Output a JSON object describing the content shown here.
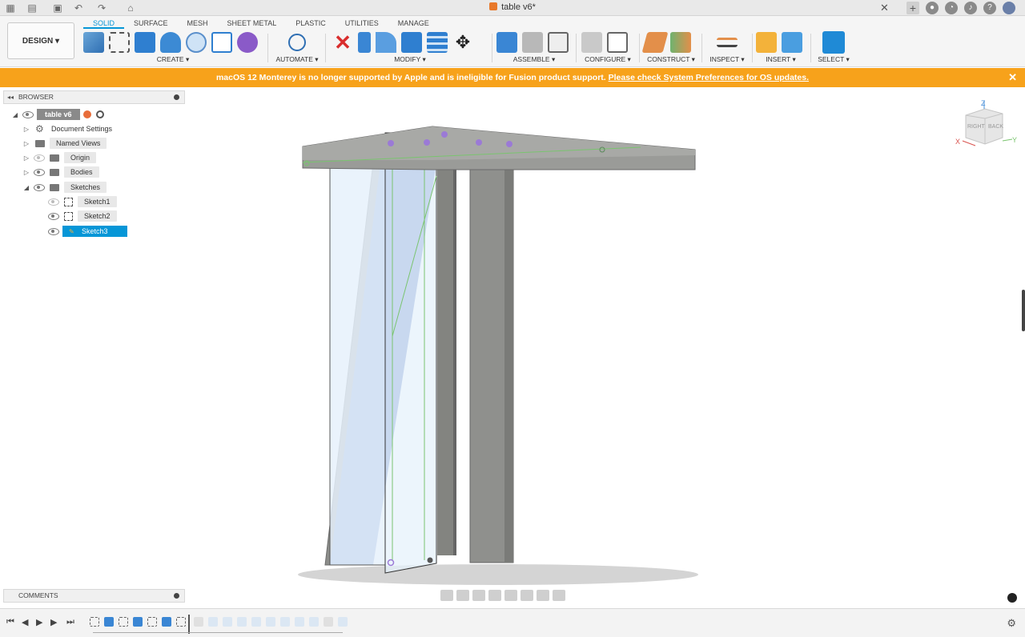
{
  "window": {
    "title": "table v6*"
  },
  "toolbar": {
    "design_label": "DESIGN",
    "tabs": [
      "SOLID",
      "SURFACE",
      "MESH",
      "SHEET METAL",
      "PLASTIC",
      "UTILITIES",
      "MANAGE"
    ],
    "active_tab": "SOLID",
    "groups": {
      "create": "CREATE",
      "automate": "AUTOMATE",
      "modify": "MODIFY",
      "assemble": "ASSEMBLE",
      "configure": "CONFIGURE",
      "construct": "CONSTRUCT",
      "inspect": "INSPECT",
      "insert": "INSERT",
      "select": "SELECT"
    }
  },
  "banner": {
    "message": "macOS 12 Monterey is no longer supported by Apple and is ineligible for Fusion product support.",
    "link": "Please check System Preferences for OS updates."
  },
  "browser": {
    "title": "BROWSER",
    "root": "table v6",
    "items": [
      "Document Settings",
      "Named Views",
      "Origin",
      "Bodies",
      "Sketches"
    ],
    "sketches": [
      "Sketch1",
      "Sketch2",
      "Sketch3"
    ]
  },
  "comments": {
    "title": "COMMENTS"
  },
  "viewcube": {
    "top": "Z",
    "x": "X",
    "y": "Y",
    "right_face": "RIGHT",
    "back_face": "BACK"
  },
  "colors": {
    "accent": "#0696d7",
    "banner": "#f7a21b",
    "body_gray": "#8f908d",
    "face_blue": "#6f8acb",
    "sketch_fill": "#e6f1fb"
  },
  "icons": {
    "home": "home-icon",
    "grid": "app-grid-icon",
    "save": "save-icon",
    "undo": "undo-icon",
    "redo": "redo-icon",
    "close": "close-icon",
    "settings": "gear-icon"
  }
}
